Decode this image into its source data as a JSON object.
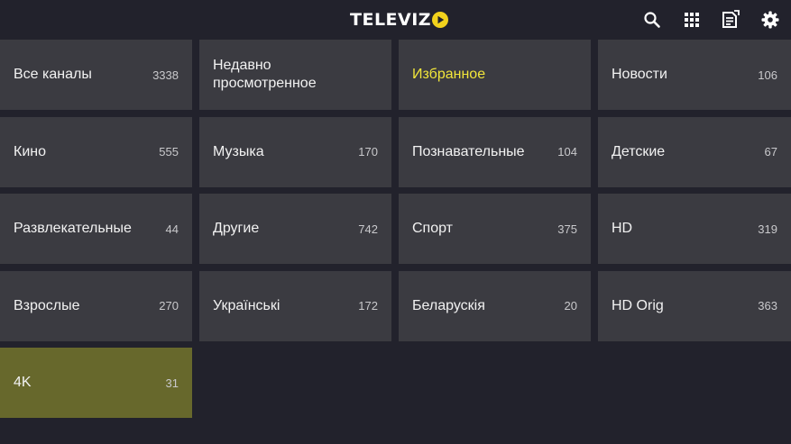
{
  "header": {
    "logo_text": "TELEVIZ",
    "logo_accent_color": "#f2d21c",
    "icons": [
      "search-icon",
      "grid-icon",
      "guide-icon",
      "gear-icon"
    ]
  },
  "colors": {
    "background": "#22222c",
    "tile": "#3b3b41",
    "tile_focused": "#67682c",
    "favorite_text": "#f2e63a"
  },
  "categories": [
    {
      "name": "Все каналы",
      "count": "3338"
    },
    {
      "name": "Недавно просмотренное",
      "count": ""
    },
    {
      "name": "Избранное",
      "count": "",
      "highlight": true
    },
    {
      "name": "Новости",
      "count": "106"
    },
    {
      "name": "Кино",
      "count": "555"
    },
    {
      "name": "Музыка",
      "count": "170"
    },
    {
      "name": "Познавательные",
      "count": "104"
    },
    {
      "name": "Детские",
      "count": "67"
    },
    {
      "name": "Развлекательные",
      "count": "44"
    },
    {
      "name": "Другие",
      "count": "742"
    },
    {
      "name": "Спорт",
      "count": "375"
    },
    {
      "name": "HD",
      "count": "319"
    },
    {
      "name": "Взрослые",
      "count": "270"
    },
    {
      "name": "Українські",
      "count": "172"
    },
    {
      "name": "Беларускія",
      "count": "20"
    },
    {
      "name": "HD Orig",
      "count": "363"
    },
    {
      "name": "4K",
      "count": "31",
      "focused": true
    }
  ]
}
